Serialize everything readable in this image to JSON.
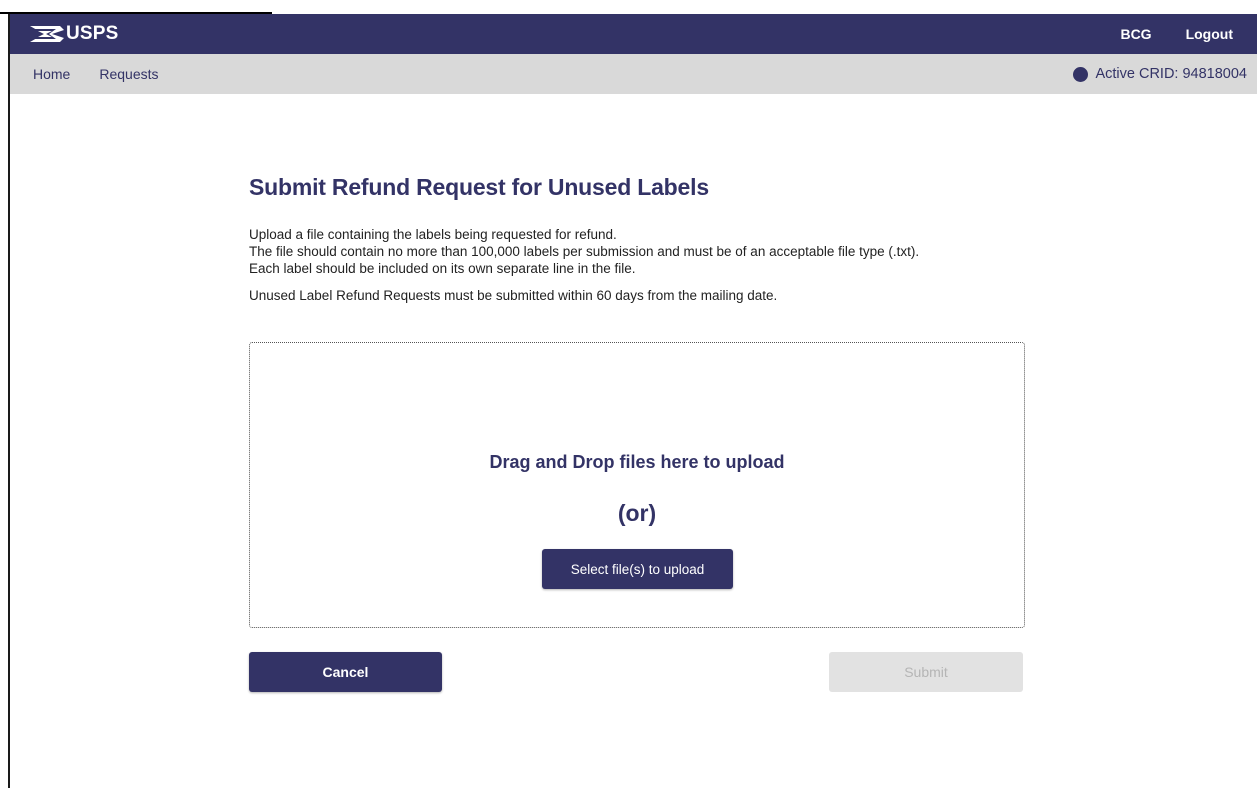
{
  "header": {
    "brand": "USPS",
    "links": [
      "BCG",
      "Logout"
    ]
  },
  "subnav": {
    "items": [
      "Home",
      "Requests"
    ],
    "crid_label": "Active CRID: 94818004"
  },
  "page": {
    "title": "Submit Refund Request for Unused Labels",
    "desc_lines": [
      "Upload a file containing the labels being requested for refund.",
      "The file should contain no more than 100,000 labels per submission and must be of an acceptable file type (.txt).",
      "Each label should be included on its own separate line in the file."
    ],
    "notice": "Unused Label Refund Requests must be submitted within 60 days from the mailing date."
  },
  "dropzone": {
    "title": "Drag and Drop files here to upload",
    "or_text": "(or)",
    "select_label": "Select file(s) to upload"
  },
  "actions": {
    "cancel_label": "Cancel",
    "submit_label": "Submit"
  },
  "colors": {
    "primary": "#333366",
    "subnav_bg": "#d9d9d9",
    "disabled_bg": "#e2e2e2"
  }
}
